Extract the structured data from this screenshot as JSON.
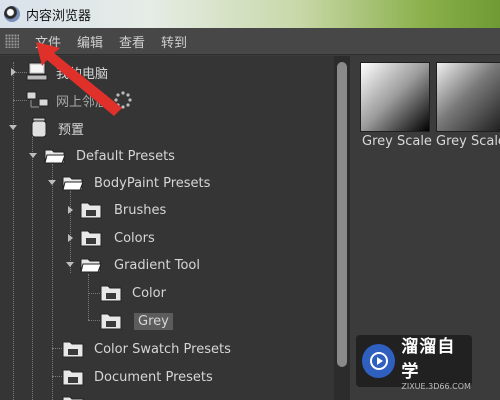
{
  "window": {
    "title": "内容浏览器"
  },
  "menubar": {
    "items": [
      "文件",
      "编辑",
      "查看",
      "转到"
    ]
  },
  "tree": {
    "my_computer": "我的电脑",
    "network": "网上邻居",
    "presets": "预置",
    "default_presets": "Default Presets",
    "bodypaint_presets": "BodyPaint Presets",
    "brushes": "Brushes",
    "colors": "Colors",
    "gradient_tool": "Gradient Tool",
    "color": "Color",
    "grey": "Grey",
    "color_swatch_presets": "Color Swatch Presets",
    "document_presets": "Document Presets"
  },
  "preview": {
    "items": [
      "Grey Scale",
      "Grey Scale."
    ]
  },
  "watermark": {
    "title": "溜溜自学",
    "url": "ZIXUE.3D66.COM"
  },
  "colors": {
    "annotation_arrow": "#e0302a",
    "watermark_blue": "#2f5fbf"
  }
}
